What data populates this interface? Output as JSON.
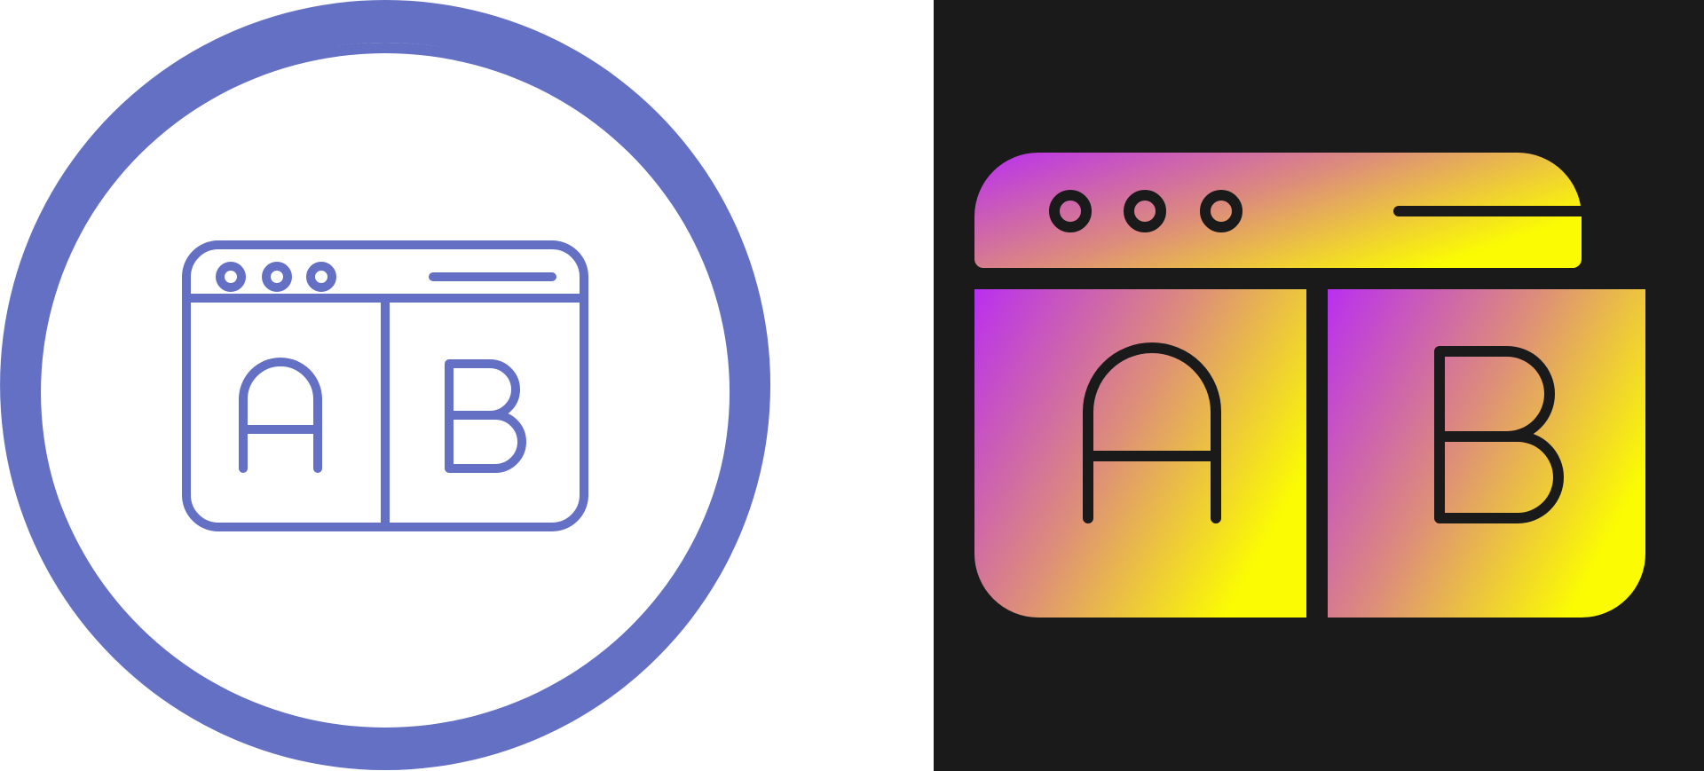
{
  "colors": {
    "left_background": "#ffffff",
    "right_background": "#1a1a1a",
    "outline_icon": "#6470c3",
    "gradient_start": "#b92ff0",
    "gradient_mid": "#dc8a7e",
    "gradient_end": "#fbfb03",
    "glyph_stroke": "#1a1a1a"
  },
  "left_icon": {
    "name": "ab-testing-browser-outline-icon",
    "style": "outline-in-circle",
    "letters": {
      "a": "A",
      "b": "B"
    }
  },
  "right_icon": {
    "name": "ab-testing-browser-gradient-icon",
    "style": "gradient-filled",
    "letters": {
      "a": "A",
      "b": "B"
    }
  }
}
